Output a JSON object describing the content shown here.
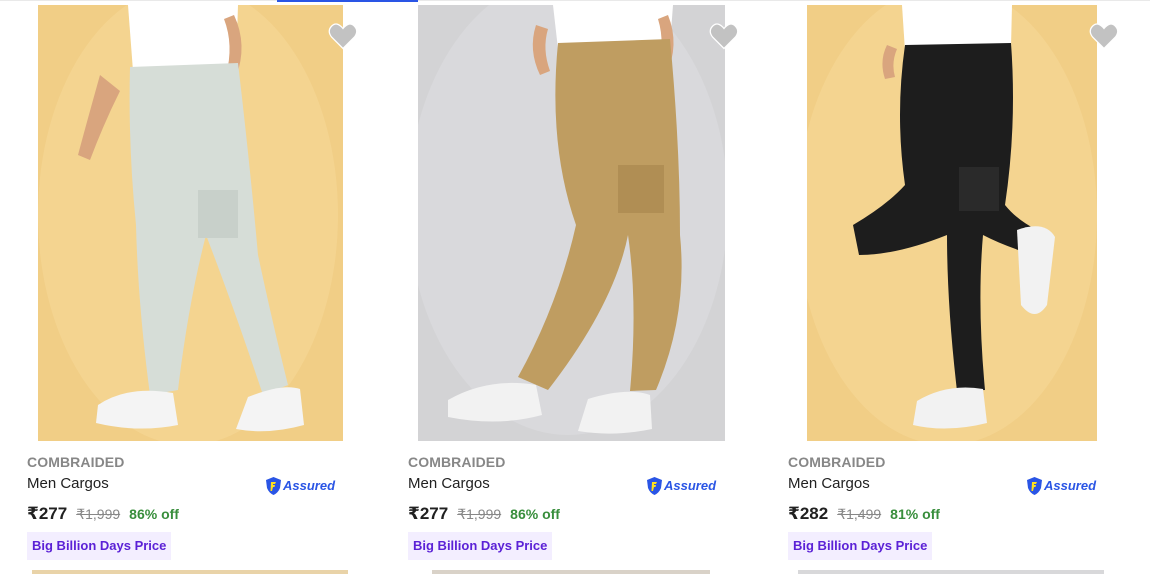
{
  "products": [
    {
      "brand": "COMBRAIDED",
      "title": "Men Cargos",
      "price": "₹277",
      "mrp": "₹1,999",
      "discount": "86% off",
      "badge": "Big Billion Days Price",
      "assured": "Assured",
      "image": {
        "background": "#f1ce86",
        "pant_color": "#d6ddd7"
      }
    },
    {
      "brand": "COMBRAIDED",
      "title": "Men Cargos",
      "price": "₹277",
      "mrp": "₹1,999",
      "discount": "86% off",
      "badge": "Big Billion Days Price",
      "assured": "Assured",
      "image": {
        "background": "#d3d3d5",
        "pant_color": "#bf9d61"
      }
    },
    {
      "brand": "COMBRAIDED",
      "title": "Men Cargos",
      "price": "₹282",
      "mrp": "₹1,499",
      "discount": "81% off",
      "badge": "Big Billion Days Price",
      "assured": "Assured",
      "image": {
        "background": "#f1ce86",
        "pant_color": "#1d1d1d"
      }
    }
  ],
  "icons": {
    "wishlist": "heart-icon",
    "assured": "shield-icon"
  },
  "colors": {
    "accent": "#2a55e5",
    "discount": "#388e3c",
    "badge_text": "#5b21d6",
    "badge_bg": "#f3eeff"
  }
}
